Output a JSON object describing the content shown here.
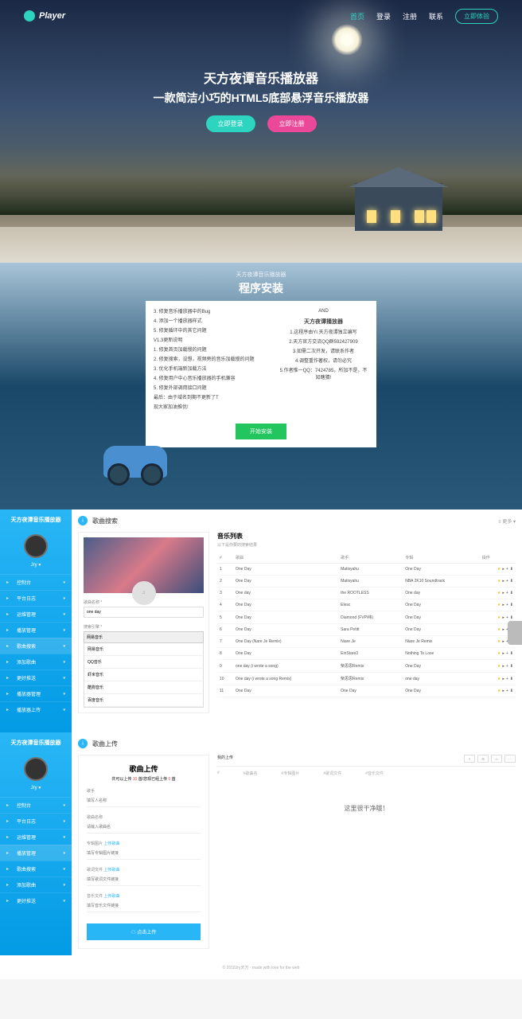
{
  "brand": "Player",
  "nav": {
    "home": "首页",
    "login": "登录",
    "register": "注册",
    "contact": "联系",
    "demo": "立即体验"
  },
  "hero": {
    "title": "天方夜谭音乐播放器",
    "subtitle": "一款简洁小巧的HTML5底部悬浮音乐播放器",
    "btn1": "立即登录",
    "btn2": "立即注册"
  },
  "install": {
    "label": "天方夜谭音乐播放器",
    "title": "程序安装",
    "left": [
      "3. 修复音乐播放器中的Bug",
      "4. 添加一个播放器样式",
      "5. 修复循环中的其它问题",
      "V1.3更新说明",
      "1. 修复首页加载慢的问题",
      "2. 修复搜索，设想，视频旁的音乐加载慢的问题",
      "3. 优化手机端新加载方法",
      "4. 修复用户中心音乐播放器的手机兼容",
      "5. 修复外部调用接口问题",
      "最后：由于域名到期不更新了T",
      "现大家加油推优!"
    ],
    "and": "AND",
    "rtitle": "天方夜谭播放器",
    "right": [
      "1.这程序由YI.天方夜谭独立编写",
      "2.天方官方交流QQ群592427909",
      "3.如需二次开发，请联系作者",
      "4.调整重作著权，请勿必究",
      "5.作者惟一QQ：7424785，所加不是，不知瞎猜!"
    ],
    "btn": "开始安装"
  },
  "sidebar": {
    "title": "天方夜谭音乐播放器",
    "user": "Jry ▾",
    "items": [
      "控制台",
      "平台日志",
      "运维管理",
      "播放管理",
      "歌曲搜索",
      "添加歌曲",
      "更好推送",
      "播放器管理",
      "播放器上传"
    ],
    "items2": [
      "控制台",
      "平台日志",
      "运维管理",
      "播放管理",
      "歌曲搜索",
      "添加歌曲",
      "更好推送"
    ]
  },
  "search": {
    "header": "歌曲搜索",
    "more": "≡ 更多 ▾",
    "label1": "歌曲名称 *",
    "val1": "one day",
    "label2": "搜索引擎 *",
    "selected": "网易音乐",
    "options": [
      "网易音乐",
      "QQ音乐",
      "虾米音乐",
      "酷狗音乐",
      "百度音乐"
    ]
  },
  "list": {
    "title": "音乐列表",
    "sub": "以下是你要的搜索结果",
    "cols": [
      "#",
      "歌曲",
      "歌手",
      "专辑",
      "操作"
    ],
    "rows": [
      [
        "1",
        "One Day",
        "Matisyahu",
        "One Day"
      ],
      [
        "2",
        "One Day",
        "Matisyahu",
        "NBA 2K10 Soundtrack"
      ],
      [
        "3",
        "One day",
        "the ROOTLESS",
        "One day"
      ],
      [
        "4",
        "One Day",
        "Elesc",
        "One Day"
      ],
      [
        "5",
        "One Day",
        "Diamond (FVP/纬)",
        "One Day"
      ],
      [
        "6",
        "One Day",
        "Sara Petitt",
        "One Day"
      ],
      [
        "7",
        "One Day (Nare Je Remix)",
        "Niare Je",
        "Niare Je Remix"
      ],
      [
        "8",
        "One Day",
        "EinStare3",
        "Nothing To Lose"
      ],
      [
        "9",
        "one day (i wrote a song)",
        "柴思思Remix",
        "One Day"
      ],
      [
        "10",
        "One day (i wrote a song Remix)",
        "柴思思Remix",
        "one day"
      ],
      [
        "11",
        "One Day",
        "One Day",
        "One Day"
      ]
    ]
  },
  "upload": {
    "header": "歌曲上传",
    "title": "歌曲上传",
    "sub1": "共可以上传",
    "sub2": "10",
    "sub3": "首/您现已经上传",
    "sub4": "0",
    "sub5": "首",
    "labels": [
      "歌手",
      "歌曲名称"
    ],
    "ph": [
      "填写人名称",
      "请输入歌曲名"
    ],
    "l_cover": "专辑图片",
    "l_lrc": "歌词文件",
    "l_music": "音乐文件",
    "action": "上传歌曲",
    "ph_cover": "填写专辑图片链接",
    "ph_lrc": "填写歌词文件链接",
    "ph_music": "填写音乐文件链接",
    "btn": "☁ 点击上传"
  },
  "empty": {
    "tab1": "我的上传",
    "th": [
      "#",
      "#歌曲名",
      "#专辑图片",
      "#歌词文件",
      "#音乐文件"
    ],
    "msg": "这里很干净哦！"
  },
  "footer": "© 2018Jry天方 · made with love for the web"
}
